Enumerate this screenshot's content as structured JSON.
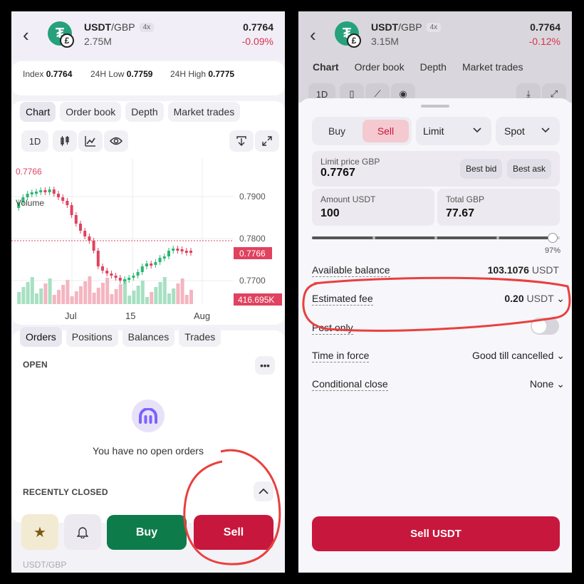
{
  "left": {
    "header": {
      "base": "USDT",
      "quote": "/GBP",
      "leverage": "4x",
      "volume": "2.75M",
      "price": "0.7764",
      "change": "-0.09%"
    },
    "stats": {
      "index_label": "Index",
      "index_value": "0.7764",
      "low_label": "24H Low",
      "low_value": "0.7759",
      "high_label": "24H High",
      "high_value": "0.7775"
    },
    "chart_tabs": [
      "Chart",
      "Order book",
      "Depth",
      "Market trades"
    ],
    "timeframe": "1D",
    "chart": {
      "top_left_label": "0.7766",
      "volume_label": "Volume",
      "y_ticks": [
        "0.7900",
        "0.7800",
        "0.7700"
      ],
      "x_ticks": [
        "Jul",
        "15",
        "Aug"
      ],
      "current_price_tag": "0.7766",
      "volume_tag": "416.695K"
    },
    "order_tabs": [
      "Orders",
      "Positions",
      "Balances",
      "Trades"
    ],
    "open_label": "OPEN",
    "empty_text": "You have no open orders",
    "recently_closed": "RECENTLY CLOSED",
    "buy_label": "Buy",
    "sell_label": "Sell",
    "footer_text": "USDT/GBP",
    "colors": {
      "buy": "#0e7c4a",
      "sell": "#c8173d",
      "up": "#2bb673",
      "down": "#e0425f"
    }
  },
  "right": {
    "header": {
      "base": "USDT",
      "quote": "/GBP",
      "leverage": "4x",
      "volume": "3.15M",
      "price": "0.7764",
      "change": "-0.12%"
    },
    "bg_tabs": [
      "Chart",
      "Order book",
      "Depth",
      "Market trades"
    ],
    "bg_timeframe": "1D",
    "buy_tab": "Buy",
    "sell_tab": "Sell",
    "order_type": "Limit",
    "market": "Spot",
    "limit_label": "Limit price GBP",
    "limit_value": "0.7767",
    "best_bid": "Best bid",
    "best_ask": "Best ask",
    "amount_label": "Amount USDT",
    "amount_value": "100",
    "total_label": "Total GBP",
    "total_value": "77.67",
    "slider_percent_label": "97%",
    "slider_fraction": 0.97,
    "available_label": "Available balance",
    "available_value": "103.1076",
    "available_unit": "USDT",
    "fee_label": "Estimated fee",
    "fee_value": "0.20",
    "fee_unit": "USDT",
    "post_only": "Post only",
    "tif_label": "Time in force",
    "tif_value": "Good till cancelled",
    "cond_label": "Conditional close",
    "cond_value": "None",
    "sell_button": "Sell USDT"
  }
}
